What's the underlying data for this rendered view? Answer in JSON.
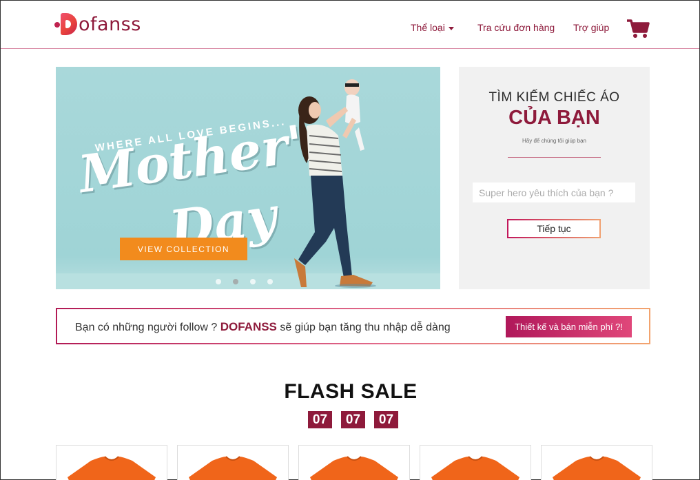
{
  "header": {
    "logo_text": "ofanss",
    "nav": {
      "categories": "Thể loại",
      "order_lookup": "Tra cứu đơn hàng",
      "help": "Trợ giúp"
    },
    "cart_icon": "cart-icon"
  },
  "banner": {
    "tagline": "WHERE ALL LOVE BEGINS...",
    "title_line1": "Mother's",
    "title_line2": "Day",
    "button": "VIEW COLLECTION",
    "slide_count": 4,
    "active_slide": 2
  },
  "search_panel": {
    "title_line1": "TÌM KIẾM CHIẾC ÁO",
    "title_line2": "CỦA BẠN",
    "subtitle": "Hãy để chúng tôi giúp bạn",
    "input_placeholder": "Super hero yêu thích của bạn ?",
    "button": "Tiếp tục"
  },
  "promo": {
    "text_before": "Bạn có những người follow ?",
    "brand": "DOFANSS",
    "text_after": "sẽ giúp bạn tăng thu nhập dễ dàng",
    "button": "Thiết kế và bán miễn phí ?!"
  },
  "flash_sale": {
    "title": "FLASH SALE",
    "countdown": [
      "07",
      "07",
      "07"
    ],
    "product_count": 5
  },
  "colors": {
    "brand": "#8e1a3b",
    "accent_orange": "#f28b1d",
    "banner_bg": "#a9d8da",
    "shirt": "#f0651a"
  }
}
